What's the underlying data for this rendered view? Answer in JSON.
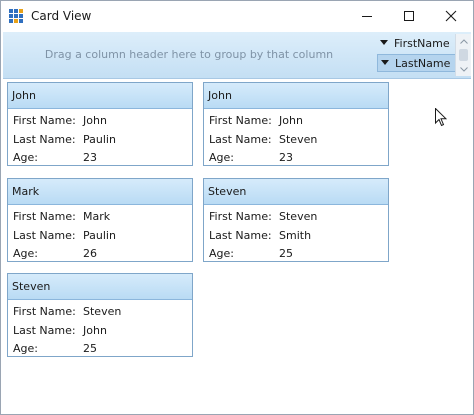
{
  "window": {
    "title": "Card View",
    "controls": {
      "minimize": "minimize",
      "maximize": "maximize",
      "close": "close"
    }
  },
  "group_panel": {
    "hint": "Drag a column header here to group by that column",
    "sort_fields": [
      {
        "label": "FirstName",
        "direction": "descending",
        "selected": false
      },
      {
        "label": "LastName",
        "direction": "descending",
        "selected": true
      }
    ]
  },
  "field_labels": {
    "first": "First Name:",
    "last": "Last Name:",
    "age": "Age:"
  },
  "cards": [
    {
      "header": "John",
      "first_name": "John",
      "last_name": "Paulin",
      "age": "23"
    },
    {
      "header": "John",
      "first_name": "John",
      "last_name": "Steven",
      "age": "23"
    },
    {
      "header": "Mark",
      "first_name": "Mark",
      "last_name": "Paulin",
      "age": "26"
    },
    {
      "header": "Steven",
      "first_name": "Steven",
      "last_name": "Smith",
      "age": "25"
    },
    {
      "header": "Steven",
      "first_name": "Steven",
      "last_name": "John",
      "age": "25"
    }
  ],
  "colors": {
    "accent": "#b9dbf4",
    "card_border": "#7fa6c9",
    "hint_text": "#7f93a6"
  }
}
